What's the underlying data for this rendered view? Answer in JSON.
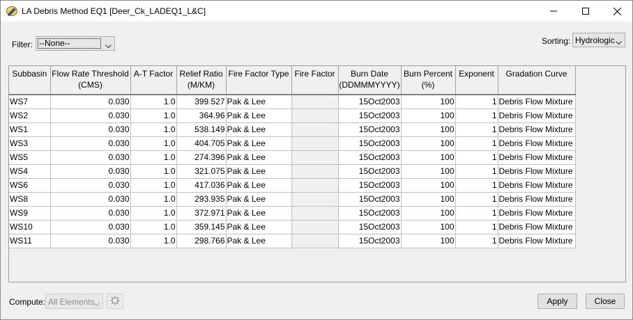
{
  "window": {
    "title": "LA Debris Method EQ1 [Deer_Ck_LADEQ1_L&C]"
  },
  "filter": {
    "label": "Filter:",
    "value": "--None--"
  },
  "sorting": {
    "label": "Sorting:",
    "value": "Hydrologic"
  },
  "table": {
    "headers": [
      "Subbasin",
      "Flow Rate Threshold\n(CMS)",
      "A-T Factor",
      "Relief Ratio\n(M/KM)",
      "Fire Factor Type",
      "Fire Factor",
      "Burn Date\n(DDMMMYYYY)",
      "Burn Percent\n(%)",
      "Exponent",
      "Gradation Curve"
    ],
    "rows": [
      [
        "WS7",
        "0.030",
        "1.0",
        "399.527",
        "Pak & Lee",
        "",
        "15Oct2003",
        "100",
        "1",
        "Debris Flow Mixture"
      ],
      [
        "WS2",
        "0.030",
        "1.0",
        "364.96",
        "Pak & Lee",
        "",
        "15Oct2003",
        "100",
        "1",
        "Debris Flow Mixture"
      ],
      [
        "WS1",
        "0.030",
        "1.0",
        "538.149",
        "Pak & Lee",
        "",
        "15Oct2003",
        "100",
        "1",
        "Debris Flow Mixture"
      ],
      [
        "WS3",
        "0.030",
        "1.0",
        "404.705",
        "Pak & Lee",
        "",
        "15Oct2003",
        "100",
        "1",
        "Debris Flow Mixture"
      ],
      [
        "WS5",
        "0.030",
        "1.0",
        "274.396",
        "Pak & Lee",
        "",
        "15Oct2003",
        "100",
        "1",
        "Debris Flow Mixture"
      ],
      [
        "WS4",
        "0.030",
        "1.0",
        "321.075",
        "Pak & Lee",
        "",
        "15Oct2003",
        "100",
        "1",
        "Debris Flow Mixture"
      ],
      [
        "WS6",
        "0.030",
        "1.0",
        "417.036",
        "Pak & Lee",
        "",
        "15Oct2003",
        "100",
        "1",
        "Debris Flow Mixture"
      ],
      [
        "WS8",
        "0.030",
        "1.0",
        "293.935",
        "Pak & Lee",
        "",
        "15Oct2003",
        "100",
        "1",
        "Debris Flow Mixture"
      ],
      [
        "WS9",
        "0.030",
        "1.0",
        "372.971",
        "Pak & Lee",
        "",
        "15Oct2003",
        "100",
        "1",
        "Debris Flow Mixture"
      ],
      [
        "WS10",
        "0.030",
        "1.0",
        "359.145",
        "Pak & Lee",
        "",
        "15Oct2003",
        "100",
        "1",
        "Debris Flow Mixture"
      ],
      [
        "WS11",
        "0.030",
        "1.0",
        "298.766",
        "Pak & Lee",
        "",
        "15Oct2003",
        "100",
        "1",
        "Debris Flow Mixture"
      ]
    ]
  },
  "compute": {
    "label": "Compute:",
    "value": "All Elements",
    "icon": "compute-icon"
  },
  "buttons": {
    "apply": "Apply",
    "close": "Close"
  },
  "icons": {
    "app": "app-pencil-icon",
    "minimize": "minimize-icon",
    "maximize": "maximize-icon",
    "close": "close-icon"
  }
}
